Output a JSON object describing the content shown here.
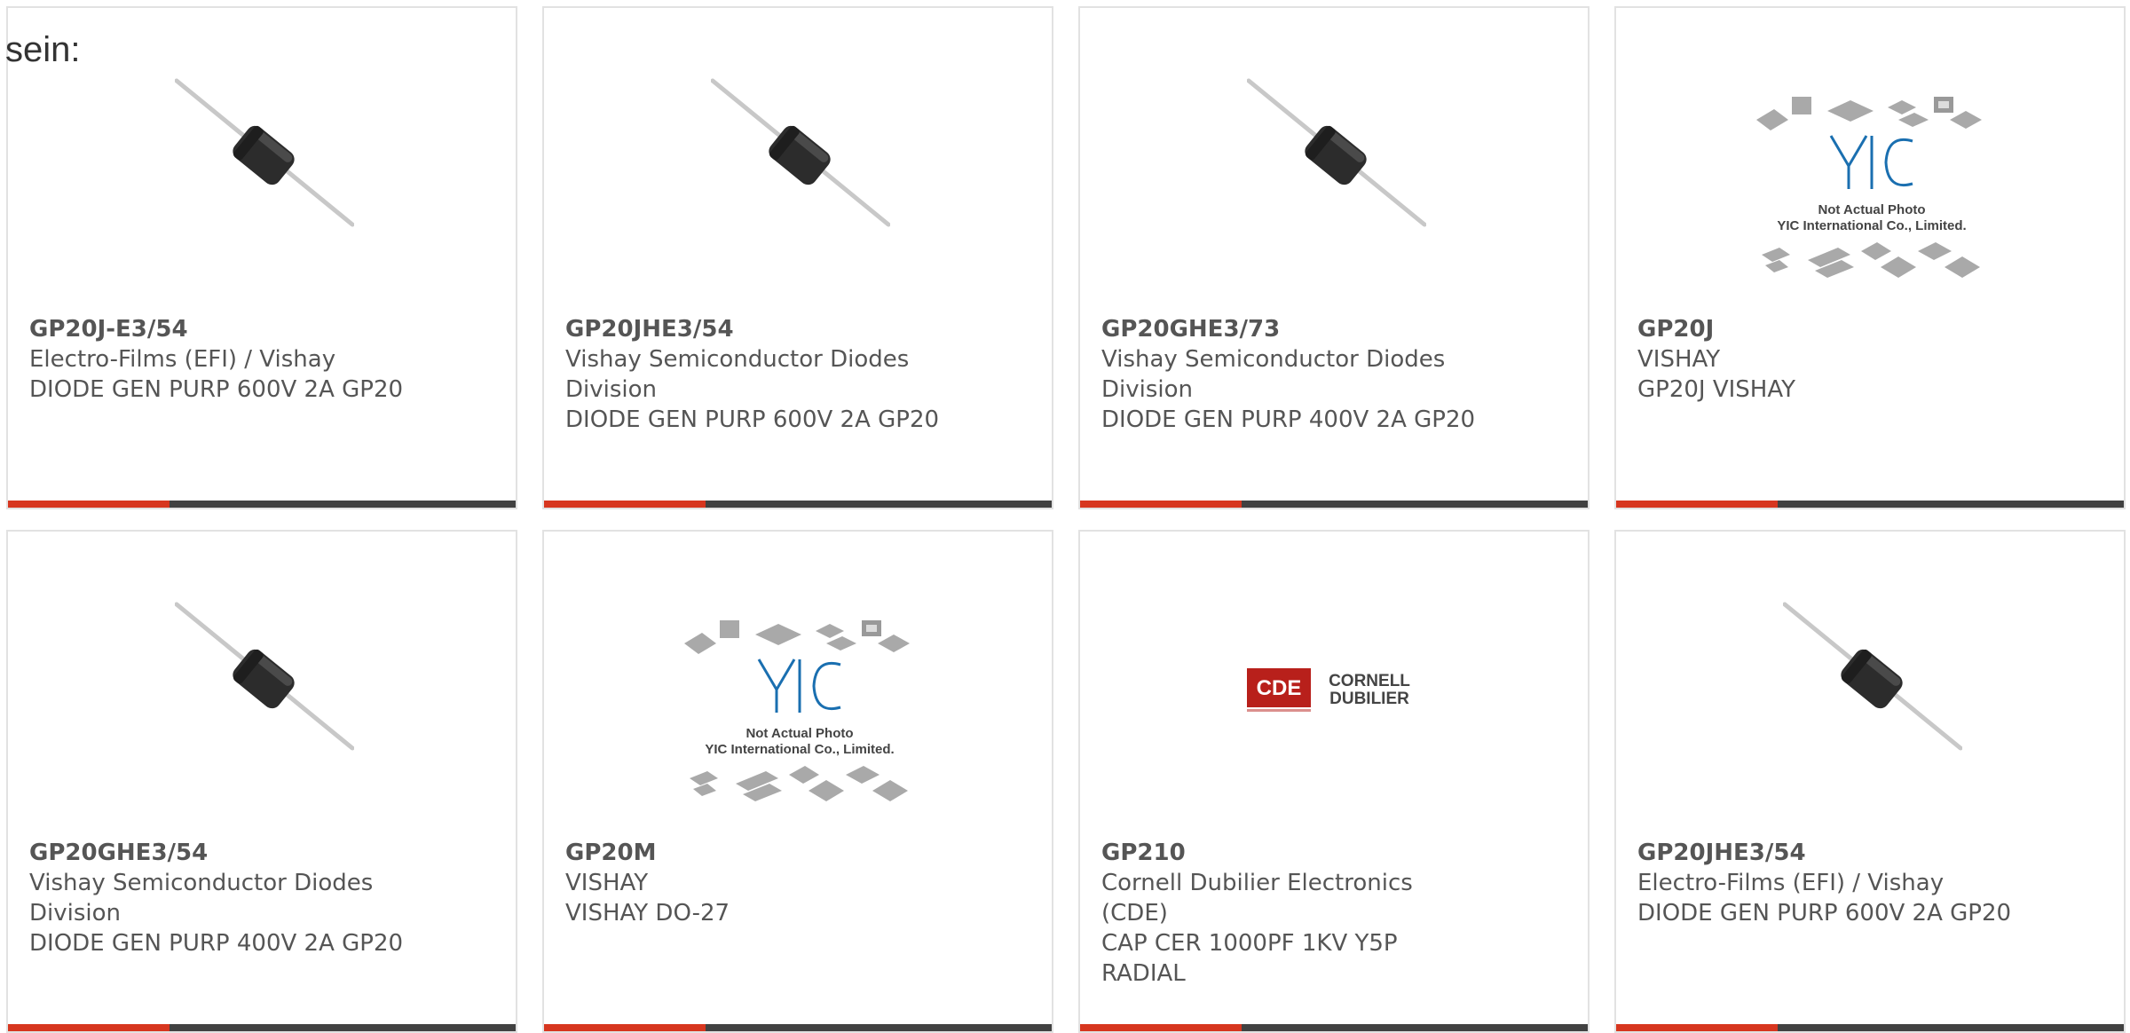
{
  "intro_text": "sein:",
  "colors": {
    "accent": "#d7361f",
    "bar": "#414141",
    "text": "#555555",
    "border": "#e2e2e2"
  },
  "products": [
    {
      "part": "GP20J-E3/54",
      "manufacturer": "Electro-Films (EFI) / Vishay",
      "description": "DIODE GEN PURP 600V 2A GP20",
      "image": "diode-photo"
    },
    {
      "part": "GP20JHE3/54",
      "manufacturer": "Vishay Semiconductor Diodes Division",
      "description": "DIODE GEN PURP 600V 2A GP20",
      "image": "diode-photo"
    },
    {
      "part": "GP20GHE3/73",
      "manufacturer": "Vishay Semiconductor Diodes Division",
      "description": "DIODE GEN PURP 400V 2A GP20",
      "image": "diode-photo"
    },
    {
      "part": "GP20J",
      "manufacturer": "VISHAY",
      "description": "GP20J VISHAY",
      "image": "yic-placeholder",
      "image_caption_1": "Not Actual Photo",
      "image_caption_2": "YIC International Co., Limited."
    },
    {
      "part": "GP20GHE3/54",
      "manufacturer": "Vishay Semiconductor Diodes Division",
      "description": "DIODE GEN PURP 400V 2A GP20",
      "image": "diode-photo"
    },
    {
      "part": "GP20M",
      "manufacturer": "VISHAY",
      "description": "VISHAY DO-27",
      "image": "yic-placeholder",
      "image_caption_1": "Not Actual Photo",
      "image_caption_2": "YIC International Co., Limited."
    },
    {
      "part": "GP210",
      "manufacturer": "Cornell Dubilier Electronics (CDE)",
      "description": "CAP CER 1000PF 1KV Y5P RADIAL",
      "image": "cde-logo",
      "logo_mark": "CDE",
      "logo_name_1": "CORNELL",
      "logo_name_2": "DUBILIER"
    },
    {
      "part": "GP20JHE3/54",
      "manufacturer": "Electro-Films (EFI) / Vishay",
      "description": "DIODE GEN PURP 600V 2A GP20",
      "image": "diode-photo"
    }
  ]
}
